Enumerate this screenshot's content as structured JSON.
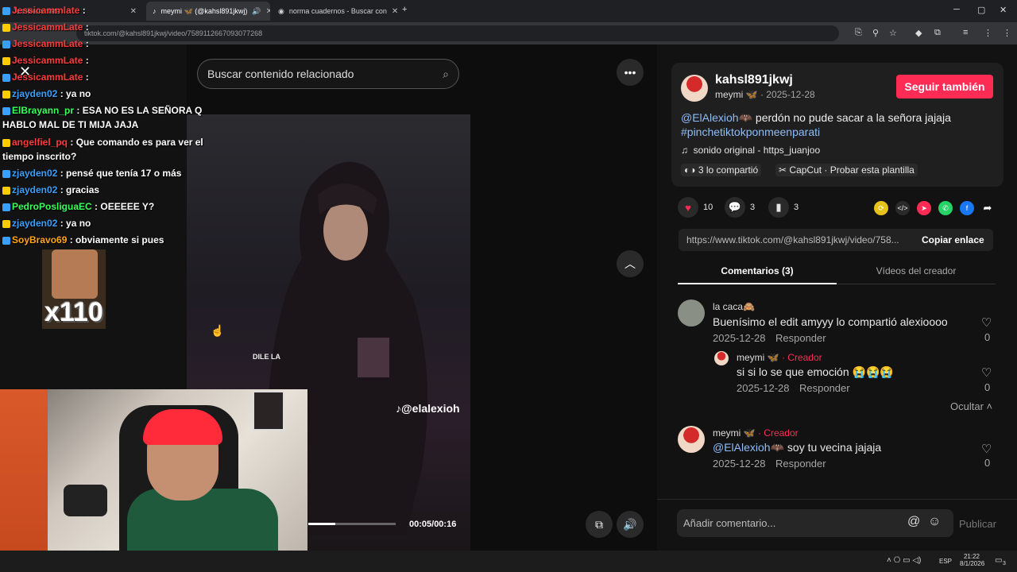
{
  "browser": {
    "tabs": [
      {
        "label": "Jessicammlate",
        "active": false
      },
      {
        "label": "meymi 🦋 (@kahsl891jkwj)",
        "active": true
      },
      {
        "label": "norma cuadernos - Buscar con",
        "active": false
      }
    ],
    "url": "tiktok.com/@kahsl891jkwj/video/7589112667093077268"
  },
  "chat": {
    "lines": [
      {
        "user": "Jessicammlate",
        "text": ":",
        "color": "#ff3a3a"
      },
      {
        "user": "JessicammLate",
        "text": ":",
        "color": "#ff3a3a"
      },
      {
        "user": "JessicammLate",
        "text": ":",
        "color": "#ff3a3a"
      },
      {
        "user": "JessicammLate",
        "text": ":",
        "color": "#ff3a3a"
      },
      {
        "user": "JessicammLate",
        "text": ":",
        "color": "#ff3a3a"
      },
      {
        "user": "zjayden02",
        "text": ": ya no",
        "color": "#3aa0ff"
      },
      {
        "user": "ElBrayann_pr",
        "text": ": ESA NO ES LA SEÑORA Q HABLO MAL DE TI MIJA JAJA",
        "color": "#3aff5a"
      },
      {
        "user": "angelfiel_pq",
        "text": ": Que comando es para ver el tiempo inscrito?",
        "color": "#ff3a3a"
      },
      {
        "user": "zjayden02",
        "text": ": pensé que tenía 17 o más",
        "color": "#3aa0ff"
      },
      {
        "user": "zjayden02",
        "text": ": gracias",
        "color": "#3aa0ff"
      },
      {
        "user": "PedroPosliguaEC",
        "text": ": OEEEEE Y?",
        "color": "#3aff5a"
      },
      {
        "user": "zjayden02",
        "text": ": ya no",
        "color": "#3aa0ff"
      },
      {
        "user": "SoyBravo69",
        "text": ": obviamente si pues",
        "color": "#ffa51a"
      }
    ],
    "emote_text": "x110"
  },
  "video": {
    "search_placeholder": "Buscar contenido relacionado",
    "watermark": "@elalexioh",
    "caption_text": "DILE LA",
    "time": "00:05/00:16",
    "progress_fraction": 0.31
  },
  "post": {
    "username": "kahsl891jkwj",
    "display_name": "meymi 🦋",
    "date": "· 2025-12-28",
    "follow_label": "Seguir también",
    "mention": "@ElAlexioh🦇",
    "description": " perdón no pude sacar a la señora jajaja",
    "hashtag": "#pinchetiktokponmeenparati",
    "sound": "sonido original - https_juanjoo",
    "shared": "3 lo compartió",
    "capcut": "CapCut · Probar esta plantilla",
    "likes": "10",
    "comments": "3",
    "saves": "3",
    "link": "https://www.tiktok.com/@kahsl891jkwj/video/758...",
    "copy_label": "Copiar enlace"
  },
  "tabs": {
    "comments": "Comentarios (3)",
    "creator_videos": "Vídeos del creador"
  },
  "comments": [
    {
      "user": "la caca🙈",
      "text": "Buenísimo el edit amyyy lo compartió alexioooo",
      "date": "2025-12-28",
      "reply": "Responder",
      "likes": "0"
    },
    {
      "user": "meymi 🦋",
      "creator": "· Creador",
      "text": "si si lo se que emoción 😭😭😭",
      "date": "2025-12-28",
      "reply": "Responder",
      "likes": "0"
    },
    {
      "user": "meymi 🦋",
      "creator": "· Creador",
      "mention": "@ElAlexioh🦇",
      "text": " soy tu vecina jajaja",
      "date": "2025-12-28",
      "reply": "Responder",
      "likes": "0"
    }
  ],
  "hide_label": "Ocultar",
  "input": {
    "placeholder": "Añadir comentario...",
    "publish": "Publicar"
  },
  "taskbar": {
    "lang": "ESP",
    "time": "21:22",
    "date": "8/1/2026",
    "notif": "3"
  },
  "colors": {
    "accent": "#fe2c55",
    "link": "#8fbdf9",
    "creator": "#fe2c55"
  }
}
